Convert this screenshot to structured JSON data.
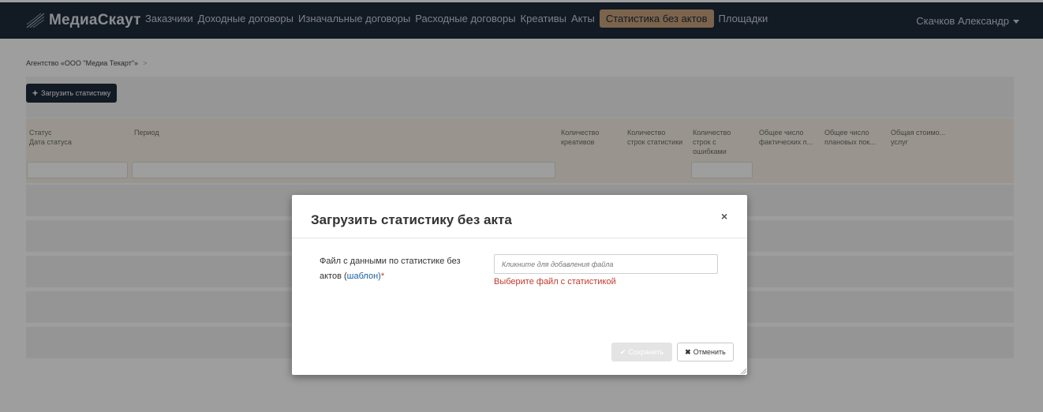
{
  "navbar": {
    "brand": "МедиаСкаут",
    "items": [
      "Заказчики",
      "Доходные договоры",
      "Изначальные договоры",
      "Расходные договоры",
      "Креативы",
      "Акты",
      "Статистика без актов",
      "Площадки"
    ],
    "active_item": "Статистика без актов",
    "user": "Скачков Александр"
  },
  "breadcrumb": {
    "agency": "Агентство «ООО \"Медиа Текарт\"»",
    "separator": ">"
  },
  "toolbar": {
    "upload_label": "Загрузить статистику"
  },
  "table": {
    "columns": [
      "Статус\nДата статуса",
      "Период",
      "Количество\nкреативов",
      "Количество\nстрок статистики",
      "Количество\nстрок с\nошибками",
      "Общее число\nфактических п...",
      "Общее число\nплановых пок...",
      "Общая стоимо...\nуслуг"
    ]
  },
  "modal": {
    "title": "Загрузить статистику без акта",
    "close_glyph": "×",
    "field_label": "Файл с данными по статистике без актов (",
    "field_link": "шаблон",
    "field_label_end": ")",
    "required_mark": "*",
    "file_placeholder": "Кликните для добавления файла",
    "error": "Выберите файл с статистикой",
    "save_label": "Сохранить",
    "cancel_label": "Отменить"
  },
  "colors": {
    "navbar_bg": "#1e2a3b",
    "accent": "#c8a27b",
    "error": "#c0392b",
    "link": "#1a5fa3"
  }
}
